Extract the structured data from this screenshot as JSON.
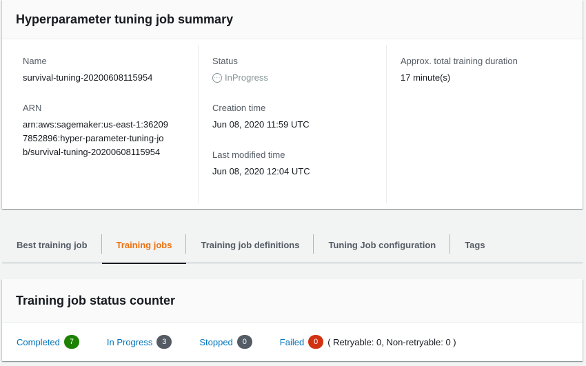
{
  "summary": {
    "title": "Hyperparameter tuning job summary",
    "name_label": "Name",
    "name_value": "survival-tuning-20200608115954",
    "arn_label": "ARN",
    "arn_value": "arn:aws:sagemaker:us-east-1:362097852896:hyper-parameter-tuning-job/survival-tuning-20200608115954",
    "status_label": "Status",
    "status_value": "InProgress",
    "creation_label": "Creation time",
    "creation_value": "Jun 08, 2020 11:59 UTC",
    "modified_label": "Last modified time",
    "modified_value": "Jun 08, 2020 12:04 UTC",
    "duration_label": "Approx. total training duration",
    "duration_value": "17 minute(s)"
  },
  "tabs": [
    {
      "label": "Best training job",
      "active": false
    },
    {
      "label": "Training jobs",
      "active": true
    },
    {
      "label": "Training job definitions",
      "active": false
    },
    {
      "label": "Tuning Job configuration",
      "active": false
    },
    {
      "label": "Tags",
      "active": false
    }
  ],
  "counter": {
    "title": "Training job status counter",
    "items": [
      {
        "label": "Completed",
        "count": "7",
        "color": "#1d8102"
      },
      {
        "label": "In Progress",
        "count": "3",
        "color": "#545b64"
      },
      {
        "label": "Stopped",
        "count": "0",
        "color": "#545b64"
      },
      {
        "label": "Failed",
        "count": "0",
        "color": "#d13212"
      }
    ],
    "failed_detail": "( Retryable: 0, Non-retryable: 0 )"
  },
  "colors": {
    "accent": "#ec7211",
    "link": "#0073bb"
  }
}
